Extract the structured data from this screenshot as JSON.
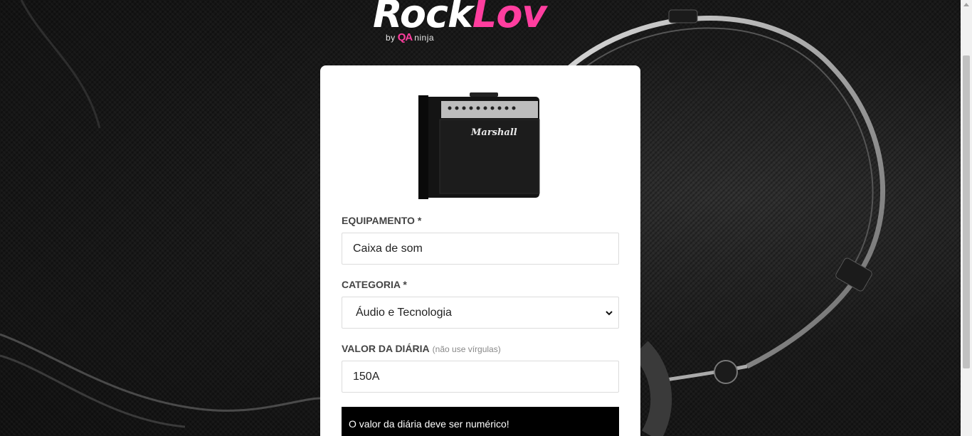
{
  "logo": {
    "brand_part1": "Rock",
    "brand_part2": "Lov",
    "by_text": "by",
    "qa_text": "QA",
    "ninja_text": "ninja",
    "accent_color": "#ff3e9f"
  },
  "form": {
    "thumbnail_icon": "amplifier-image",
    "thumbnail_brand": "Marshall",
    "equipment": {
      "label": "EQUIPAMENTO *",
      "value": "Caixa de som"
    },
    "category": {
      "label": "CATEGORIA *",
      "selected": "Áudio e Tecnologia",
      "icon": "chevron-down-icon"
    },
    "daily_price": {
      "label": "VALOR DA DIÁRIA",
      "hint": "(não use vírgulas)",
      "value": "150A"
    },
    "error_alert": "O valor da diária deve ser numérico!"
  }
}
